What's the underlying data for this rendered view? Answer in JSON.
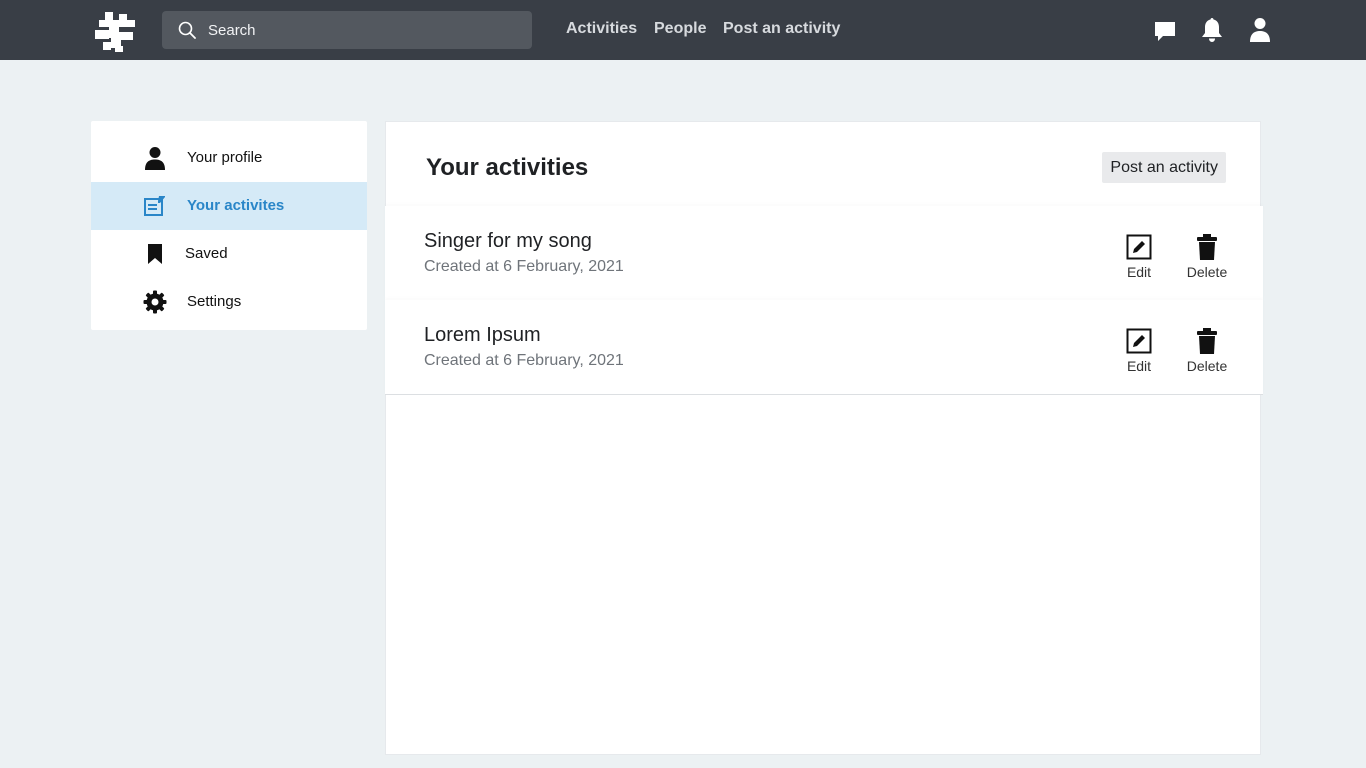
{
  "topbar": {
    "search_placeholder": "Search",
    "nav": [
      "Activities",
      "People",
      "Post an activity"
    ],
    "icons": [
      "chat-icon",
      "bell-icon",
      "user-icon"
    ],
    "background": "#393e46"
  },
  "sidebar": {
    "items": [
      {
        "label": "Your profile",
        "icon": "person-icon",
        "active": false
      },
      {
        "label": "Your activites",
        "icon": "activity-card-icon",
        "active": true
      },
      {
        "label": "Saved",
        "icon": "bookmark-icon",
        "active": false
      },
      {
        "label": "Settings",
        "icon": "gear-icon",
        "active": false
      }
    ],
    "active_color": "#2a86c8",
    "active_bg": "#d5eaf7"
  },
  "main": {
    "title": "Your activities",
    "post_button": "Post an activity",
    "activities": [
      {
        "title": "Singer for my song",
        "created": "Created at 6 February, 2021",
        "edit": "Edit",
        "delete": "Delete"
      },
      {
        "title": "Lorem Ipsum",
        "created": "Created at 6 February, 2021",
        "edit": "Edit",
        "delete": "Delete"
      }
    ]
  }
}
